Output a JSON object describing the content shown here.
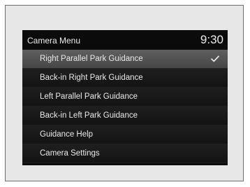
{
  "menu": {
    "title": "Camera Menu",
    "clock": "9:30",
    "items": [
      {
        "label": "Right Parallel Park Guidance",
        "selected": true
      },
      {
        "label": "Back-in Right Park Guidance",
        "selected": false
      },
      {
        "label": "Left Parallel Park Guidance",
        "selected": false
      },
      {
        "label": "Back-in Left Park Guidance",
        "selected": false
      },
      {
        "label": "Guidance Help",
        "selected": false
      },
      {
        "label": "Camera Settings",
        "selected": false
      }
    ]
  },
  "icons": {
    "selected_marker": "checkmark-icon"
  },
  "colors": {
    "screen_background": "#0b0b0b",
    "selected_row": "#555555",
    "text": "#e9e9e9",
    "frame": "#e7e7e7"
  }
}
